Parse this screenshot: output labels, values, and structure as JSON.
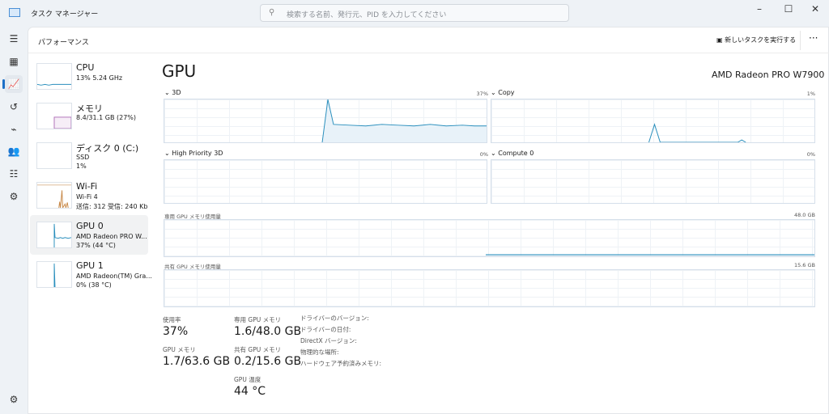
{
  "window": {
    "title": "タスク マネージャー",
    "search_placeholder": "検索する名前、発行元、PID を入力してください",
    "minimize": "–",
    "maximize": "☐",
    "close": "✕"
  },
  "header": {
    "title": "パフォーマンス",
    "new_task": "新しいタスクを実行する",
    "more": "···"
  },
  "nav": [
    "☰",
    "▦",
    "📈",
    "↺",
    "⌁",
    "👥",
    "☷",
    "⚙"
  ],
  "sidebar": [
    {
      "name": "CPU",
      "l1": "13%  5.24 GHz",
      "l2": ""
    },
    {
      "name": "メモリ",
      "l1": "8.4/31.1 GB (27%)",
      "l2": ""
    },
    {
      "name": "ディスク 0 (C:)",
      "l1": "SSD",
      "l2": "1%"
    },
    {
      "name": "Wi-Fi",
      "l1": "Wi-Fi 4",
      "l2": "送信: 312  受信: 240 Kb"
    },
    {
      "name": "GPU 0",
      "l1": "AMD Radeon PRO W...",
      "l2": "37%  (44 °C)"
    },
    {
      "name": "GPU 1",
      "l1": "AMD Radeon(TM) Gra...",
      "l2": "0%  (38 °C)"
    }
  ],
  "main": {
    "title": "GPU",
    "gpu_name": "AMD Radeon PRO W7900",
    "engines": [
      {
        "label": "3D",
        "pct": "37%"
      },
      {
        "label": "Copy",
        "pct": "1%"
      },
      {
        "label": "High Priority 3D",
        "pct": "0%"
      },
      {
        "label": "Compute 0",
        "pct": "0%"
      }
    ],
    "dedicated": {
      "label": "専用 GPU メモリ使用量",
      "max": "48.0 GB"
    },
    "shared": {
      "label": "共有 GPU メモリ使用量",
      "max": "15.6 GB"
    },
    "stats": {
      "usage_label": "使用率",
      "usage": "37%",
      "gpumem_label": "GPU メモリ",
      "gpumem": "1.7/63.6 GB",
      "ded_label": "専用 GPU メモリ",
      "ded": "1.6/48.0 GB",
      "sh_label": "共有 GPU メモリ",
      "sh": "0.2/15.6 GB",
      "temp_label": "GPU 温度",
      "temp": "44 °C",
      "details": [
        "ドライバーのバージョン:",
        "ドライバーの日付:",
        "DirectX バージョン:",
        "物理的な場所:",
        "ハードウェア予約済みメモリ:"
      ]
    }
  },
  "colors": {
    "gpu": "#2a8fbd",
    "accent": "#1c6fc7"
  }
}
